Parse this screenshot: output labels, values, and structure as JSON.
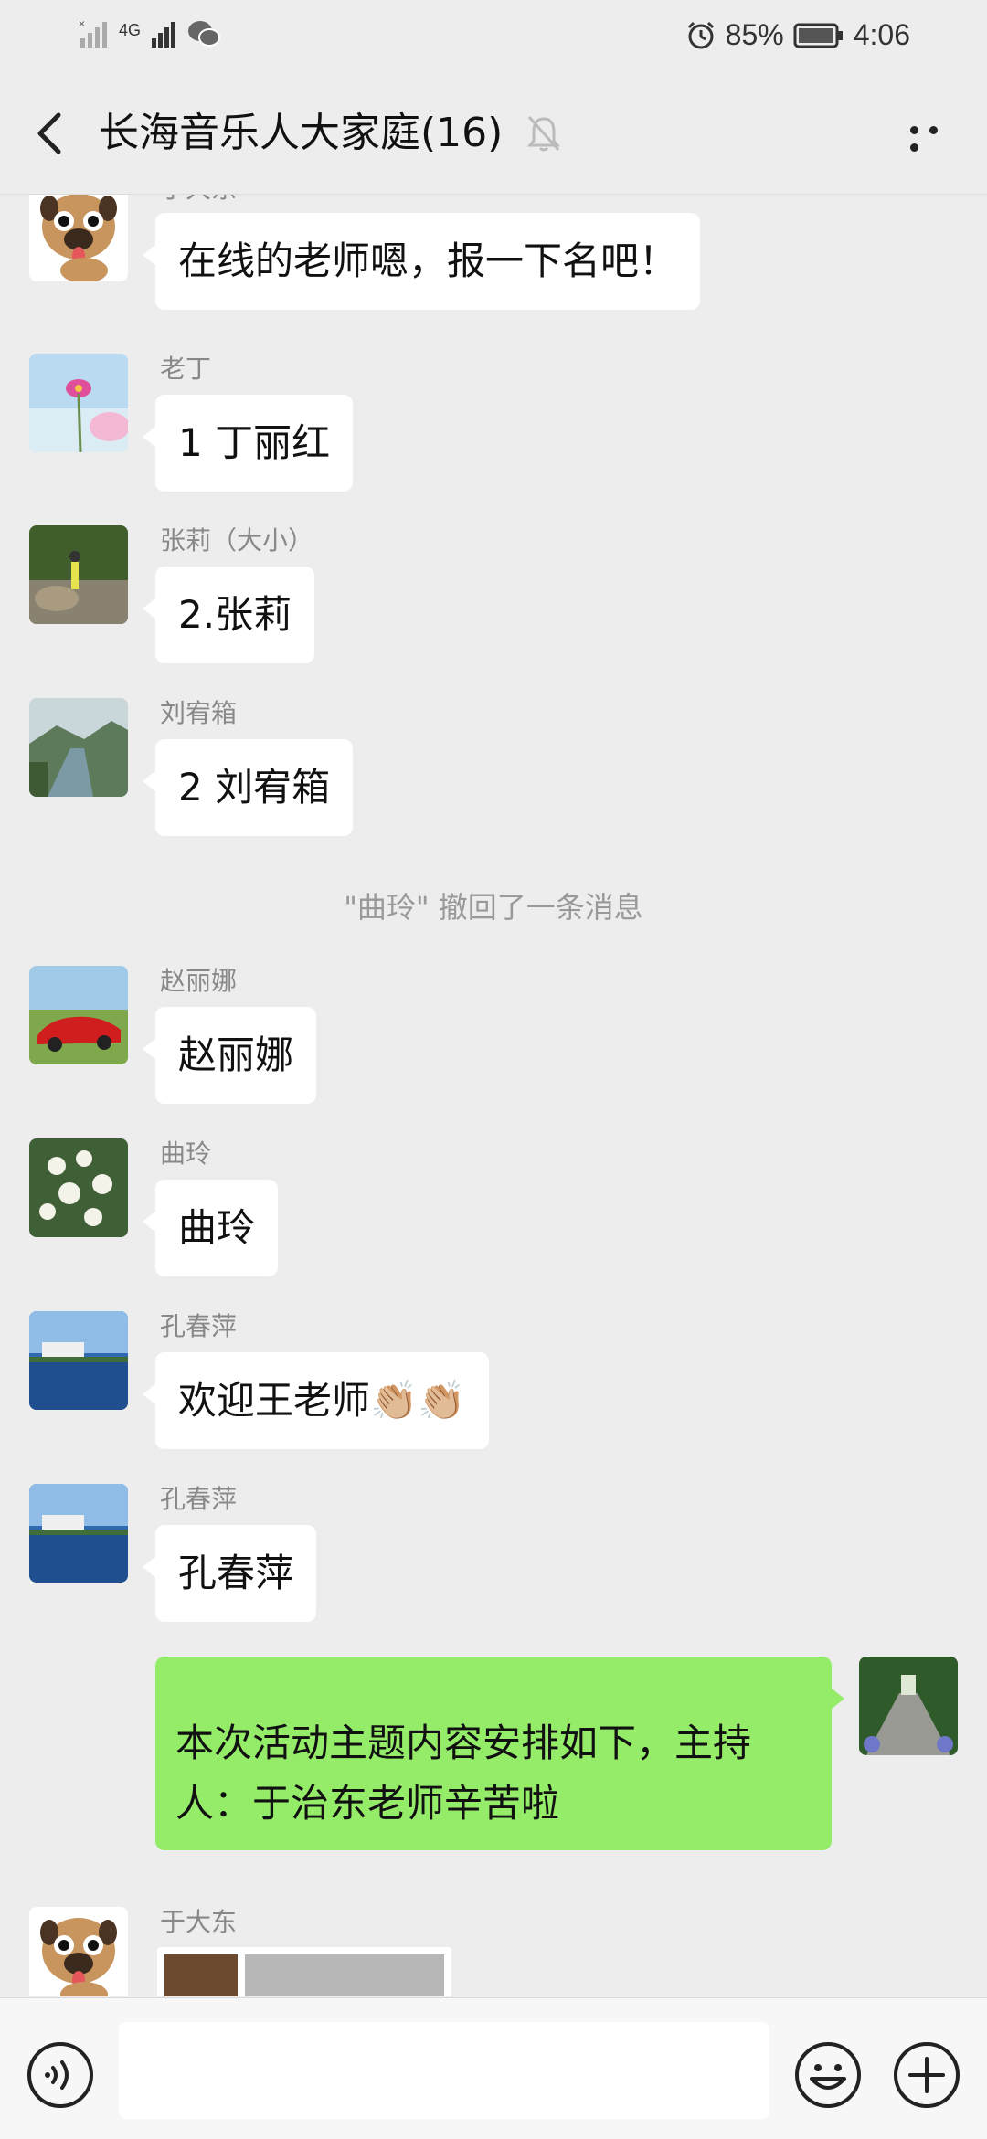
{
  "status_bar": {
    "battery": "85%",
    "time": "4:06",
    "signal_label": "4G"
  },
  "header": {
    "title": "长海音乐人大家庭(16)"
  },
  "messages": [
    {
      "sender": "于大东",
      "text": "在线的老师嗯，报一下名吧！"
    },
    {
      "sender": "老丁",
      "text": "1 丁丽红"
    },
    {
      "sender": "张莉（大小）",
      "text": "2.张莉"
    },
    {
      "sender": "刘宥箱",
      "text": "2 刘宥箱"
    },
    {
      "system": "\"曲玲\" 撤回了一条消息"
    },
    {
      "sender": "赵丽娜",
      "text": "赵丽娜"
    },
    {
      "sender": "曲玲",
      "text": "曲玲"
    },
    {
      "sender": "孔春萍",
      "text": "欢迎王老师👏🏼👏🏼"
    },
    {
      "sender": "孔春萍",
      "text": "孔春萍"
    },
    {
      "text_me": "本次活动主题内容安排如下，主持人：于治东老师辛苦啦"
    },
    {
      "sender": "于大东",
      "image": "photo-message"
    }
  ],
  "colors": {
    "background": "#ededed",
    "my_bubble": "#95ec69",
    "other_bubble": "#ffffff"
  },
  "icons": [
    "back-arrow-icon",
    "mute-bell-icon",
    "more-icon",
    "voice-icon",
    "emoji-icon",
    "plus-icon"
  ]
}
